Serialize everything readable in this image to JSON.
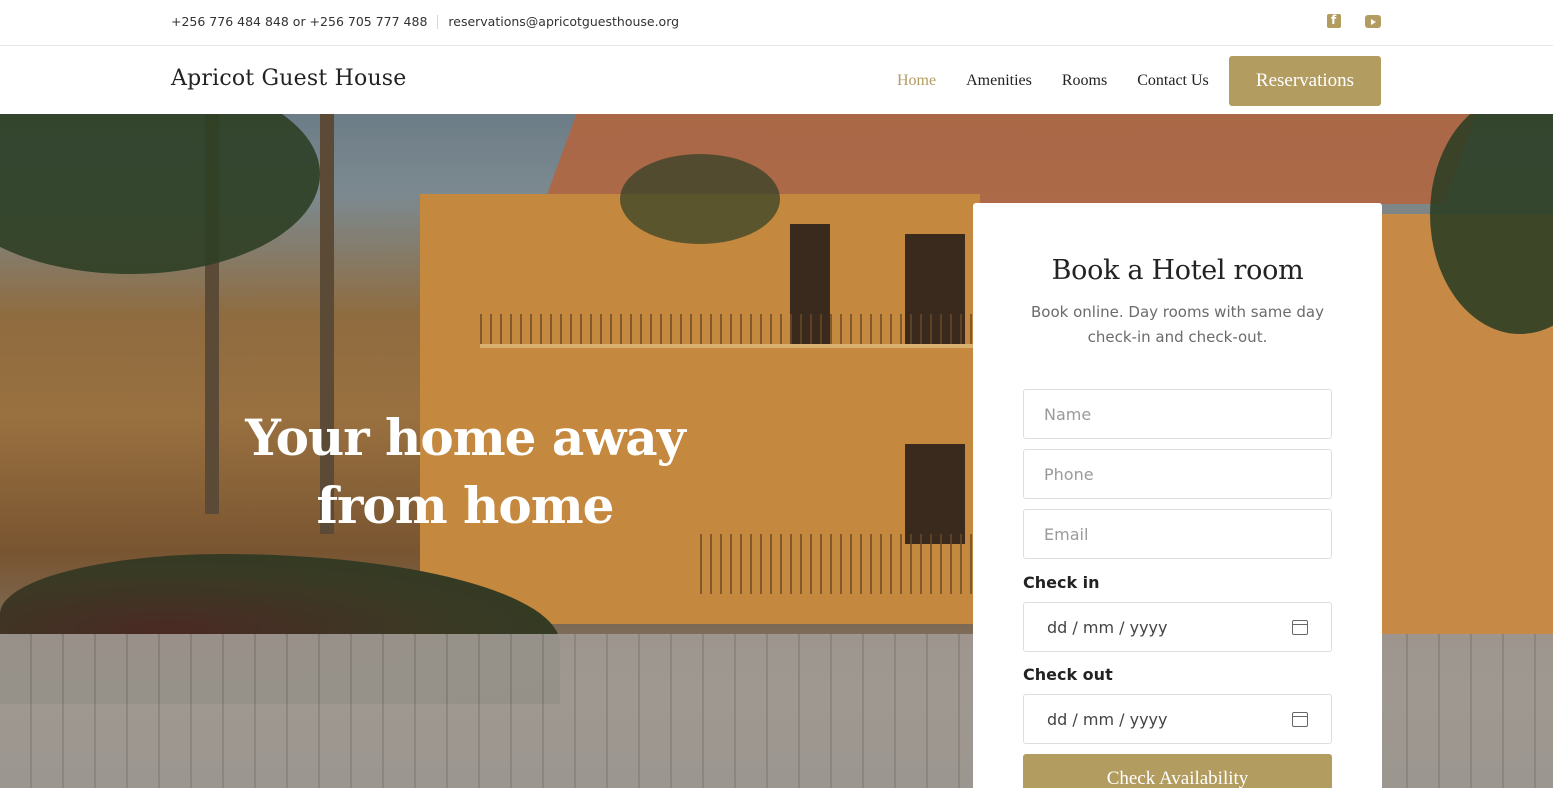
{
  "topbar": {
    "phones": "+256 776 484 848 or +256 705 777 488",
    "email": "reservations@apricotguesthouse.org",
    "social": [
      "facebook-icon",
      "youtube-icon"
    ]
  },
  "nav": {
    "brand": "Apricot Guest House",
    "items": [
      {
        "label": "Home",
        "active": true
      },
      {
        "label": "Amenities",
        "active": false
      },
      {
        "label": "Rooms",
        "active": false
      },
      {
        "label": "Contact Us",
        "active": false
      }
    ],
    "cta_label": "Reservations"
  },
  "hero": {
    "title": "Your home away from home"
  },
  "booking": {
    "title": "Book a Hotel room",
    "subtitle": "Book online. Day rooms with same day check-in and check-out.",
    "name_placeholder": "Name",
    "phone_placeholder": "Phone",
    "email_placeholder": "Email",
    "checkin_label": "Check in",
    "checkin_placeholder": "dd / mm / yyyy",
    "checkout_label": "Check out",
    "checkout_placeholder": "dd / mm / yyyy",
    "submit_label": "Check Availability"
  },
  "colors": {
    "accent": "#b39c5f",
    "text": "#222222",
    "muted": "#6b6b6b"
  }
}
